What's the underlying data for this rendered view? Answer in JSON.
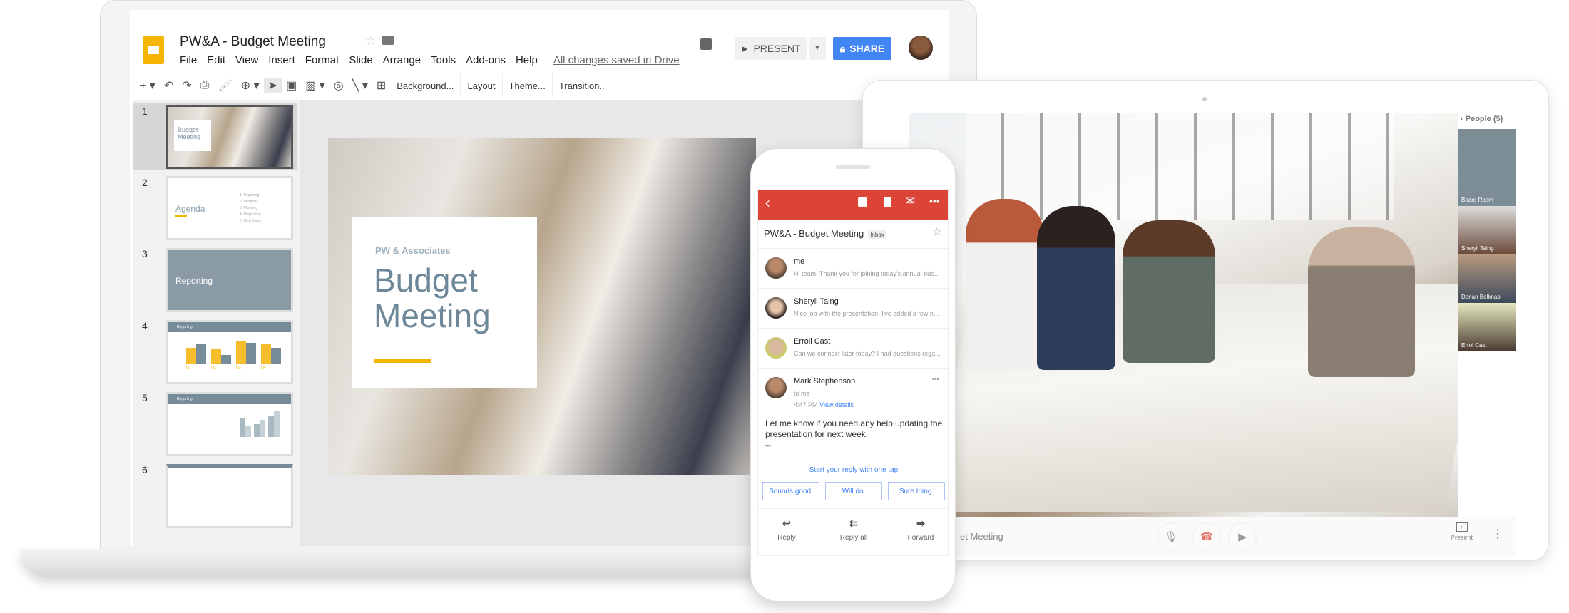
{
  "docs": {
    "title": "PW&A - Budget Meeting",
    "menu": [
      "File",
      "Edit",
      "View",
      "Insert",
      "Format",
      "Slide",
      "Arrange",
      "Tools",
      "Add-ons",
      "Help"
    ],
    "saved_status": "All changes saved in Drive",
    "present_label": "PRESENT",
    "share_label": "SHARE",
    "toolbar": {
      "background": "Background...",
      "layout": "Layout",
      "theme": "Theme...",
      "transition": "Transition.."
    },
    "slide_numbers": [
      "1",
      "2",
      "3",
      "4",
      "5",
      "6"
    ],
    "thumbs": {
      "t1_title": "Budget Meeting",
      "t2_title": "Agenda",
      "t2_items": [
        "1. Reporting",
        "2. Budgets",
        "3. Planning",
        "4. Projections",
        "5. Next Steps"
      ],
      "t3_title": "Reporting",
      "t4_title": "Reporting",
      "t4_quarters": [
        "Q1",
        "Q2",
        "Q3",
        "Q4"
      ],
      "t5_title": "Reporting"
    },
    "slide": {
      "company": "PW & Associates",
      "title_line1": "Budget",
      "title_line2": "Meeting"
    },
    "accent": "#f4b400",
    "share_color": "#4285f4"
  },
  "gmail": {
    "header_color": "#db4437",
    "subject": "PW&A - Budget Meeting",
    "label": "Inbox",
    "messages": [
      {
        "from": "me",
        "snippet": "Hi team, Thank you for joining today's annual bud..."
      },
      {
        "from": "Sheryll Taing",
        "snippet": "Nice job with the presentation. I've added a few n..."
      },
      {
        "from": "Erroll Cast",
        "snippet": "Can we connect later today? I had questions rega..."
      }
    ],
    "open": {
      "from": "Mark Stephenson",
      "to": "to me",
      "time": "4:47 PM",
      "details": "View details",
      "body": "Let me know if you need any help updating the presentation for next week.",
      "ellipsis": "•••"
    },
    "smart_prompt": "Start your reply with one tap",
    "smart_replies": [
      "Sounds good.",
      "Will do.",
      "Sure thing."
    ],
    "actions": [
      "Reply",
      "Reply all",
      "Forward"
    ]
  },
  "meet": {
    "people_header": "People (5)",
    "participants": [
      "Board Room",
      "Sheryll Taing",
      "Dorian Belknap",
      "Errol Cast"
    ],
    "meeting_name": "et Meeting",
    "present_label": "Present"
  }
}
